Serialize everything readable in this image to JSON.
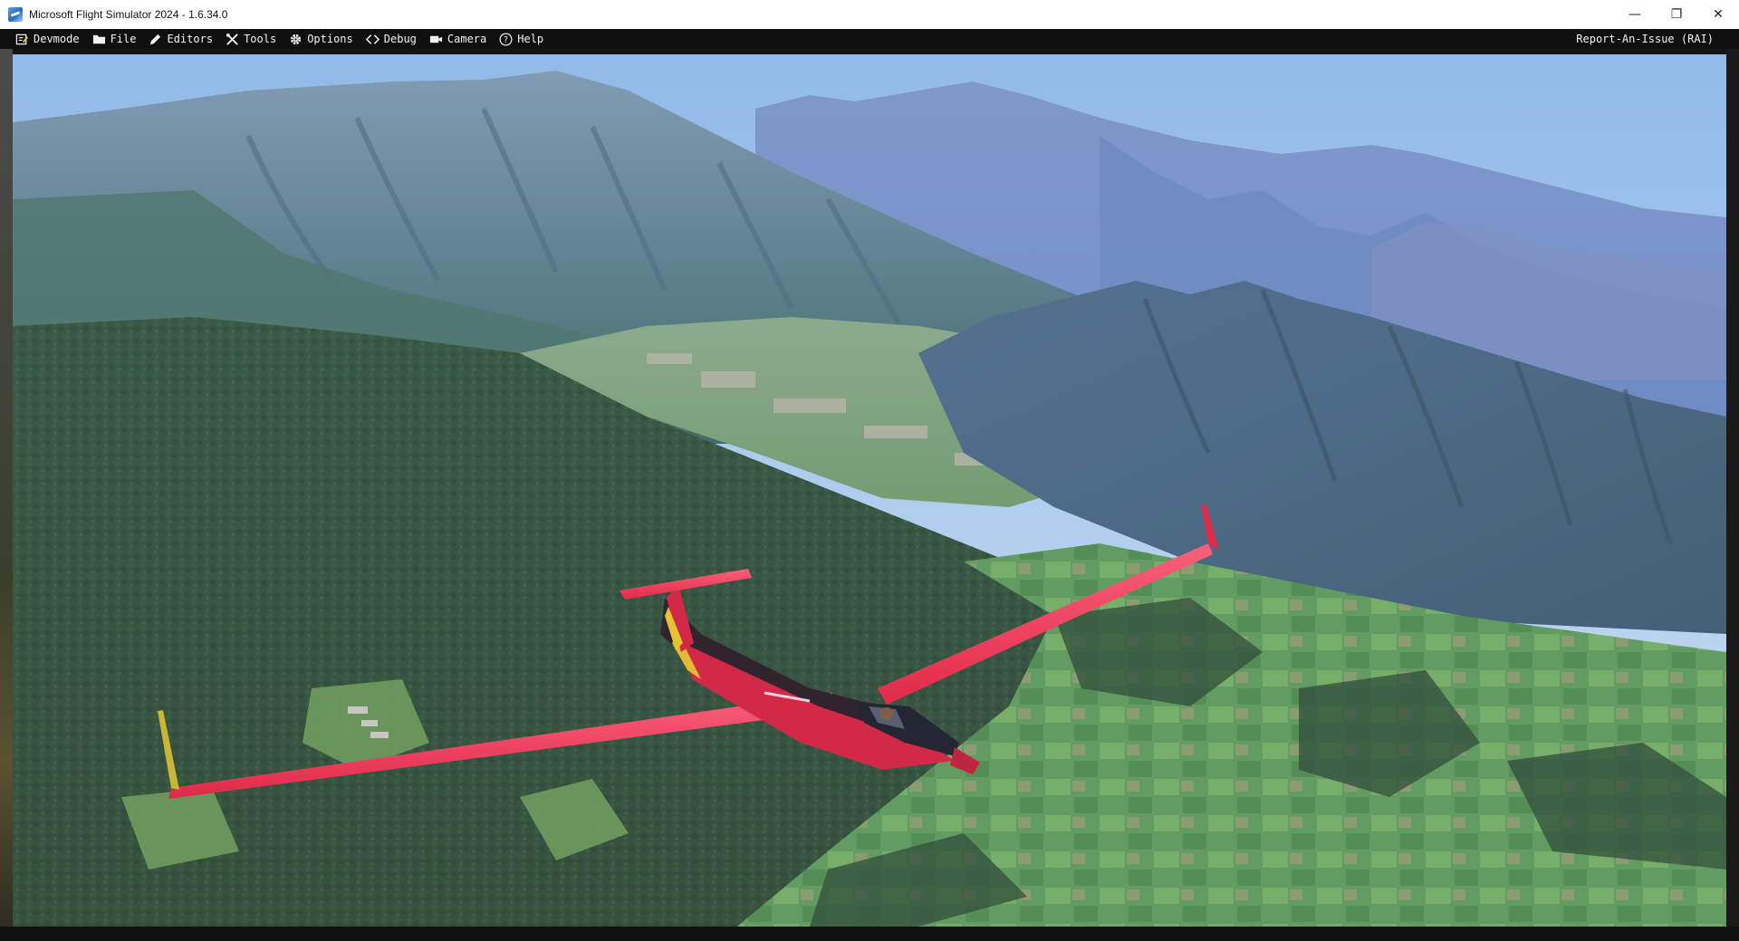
{
  "window": {
    "title": "Microsoft Flight Simulator 2024 - 1.6.34.0",
    "controls": {
      "minimize": "—",
      "restore": "❐",
      "close": "✕"
    }
  },
  "devbar": {
    "items": [
      {
        "label": "Devmode",
        "icon": "devmode-icon"
      },
      {
        "label": "File",
        "icon": "folder-icon"
      },
      {
        "label": "Editors",
        "icon": "pencil-icon"
      },
      {
        "label": "Tools",
        "icon": "tools-icon"
      },
      {
        "label": "Options",
        "icon": "gear-icon"
      },
      {
        "label": "Debug",
        "icon": "code-brackets-icon"
      },
      {
        "label": "Camera",
        "icon": "video-camera-icon"
      },
      {
        "label": "Help",
        "icon": "question-circle-icon"
      }
    ],
    "report_label": "Report-An-Issue (RAI)"
  },
  "colors": {
    "toolbar_bg": "#0f0f0f",
    "toolbar_text": "#f2f2f2",
    "glider_body": "#ee2a4a",
    "sky": "#9ec4ec",
    "forest": "#2e4a32"
  }
}
